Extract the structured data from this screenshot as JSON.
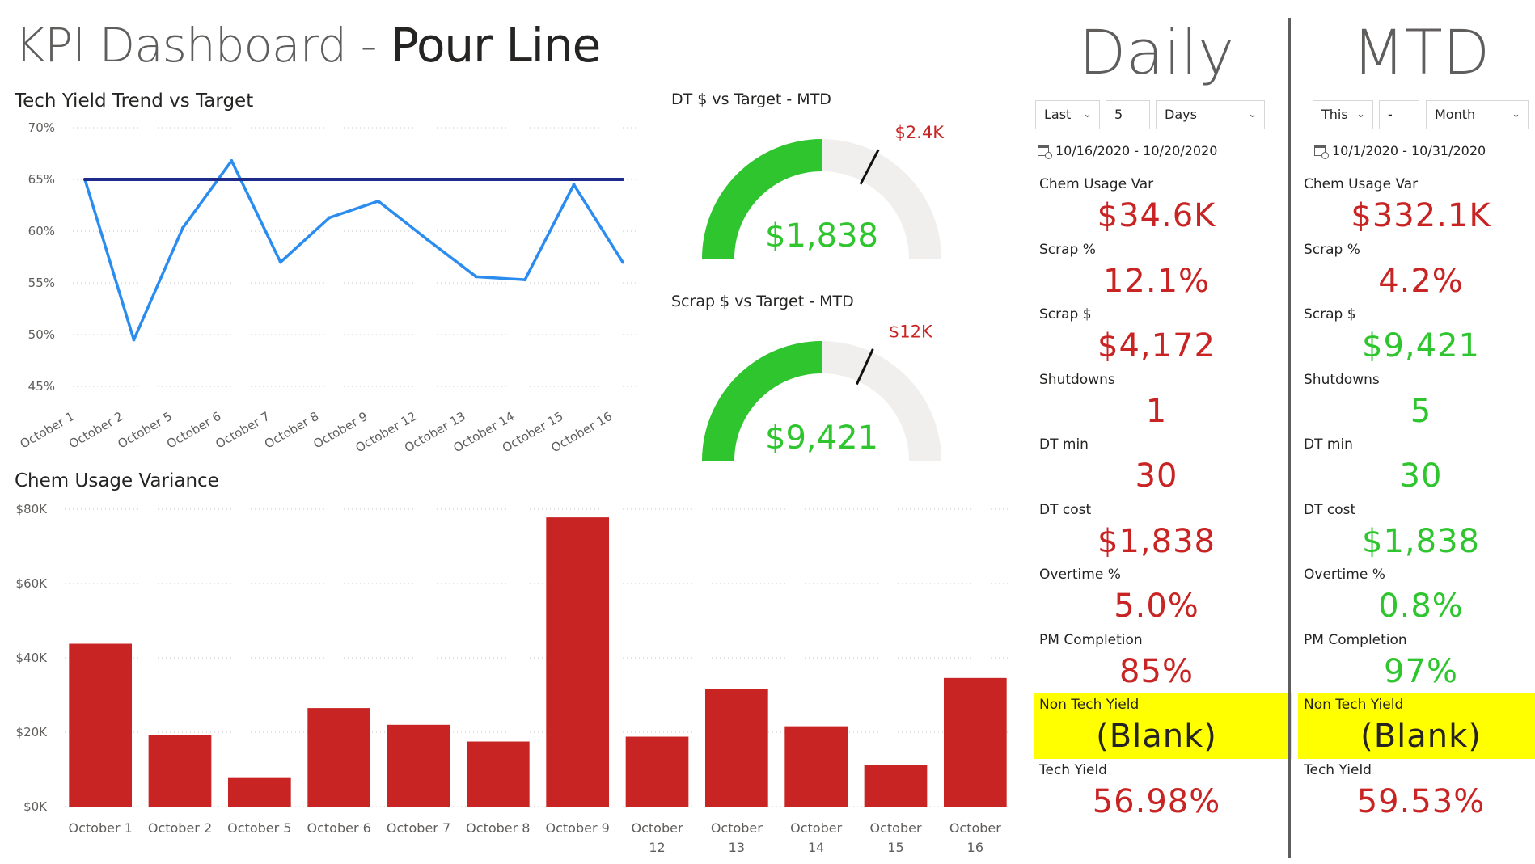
{
  "page": {
    "title_light": "KPI Dashboard - ",
    "title_bold": "Pour Line"
  },
  "tech_yield_chart": {
    "title": "Tech Yield Trend vs Target"
  },
  "chem_chart": {
    "title": "Chem Usage Variance"
  },
  "gauges": [
    {
      "title": "DT $ vs Target - MTD",
      "value_label": "$1,838",
      "target_label": "$2.4K",
      "value": 1838,
      "target": 2400,
      "max": 3676,
      "fill_color": "#2ec52e"
    },
    {
      "title": "Scrap $ vs Target - MTD",
      "value_label": "$9,421",
      "target_label": "$12K",
      "value": 9421,
      "target": 12000,
      "max": 18842,
      "fill_color": "#2ec52e"
    }
  ],
  "chart_data": [
    {
      "type": "line",
      "title": "Tech Yield Trend vs Target",
      "categories": [
        "October 1",
        "October 2",
        "October 5",
        "October 6",
        "October 7",
        "October 8",
        "October 9",
        "October 12",
        "October 13",
        "October 14",
        "October 15",
        "October 16"
      ],
      "series": [
        {
          "values": [
            65.0,
            49.5,
            60.3,
            66.8,
            57.0,
            61.3,
            62.9,
            59.2,
            55.6,
            55.3,
            64.5,
            57.0
          ],
          "color": "#2b8cf0"
        },
        {
          "values": [
            65,
            65,
            65,
            65,
            65,
            65,
            65,
            65,
            65,
            65,
            65,
            65
          ],
          "color": "#1e2a8c"
        }
      ],
      "ylim": [
        45,
        70
      ],
      "yticks": [
        "45%",
        "50%",
        "55%",
        "60%",
        "65%",
        "70%"
      ],
      "ytick_values": [
        45,
        50,
        55,
        60,
        65,
        70
      ],
      "grid": true
    },
    {
      "type": "bar",
      "title": "Chem Usage Variance",
      "categories": [
        "October 1",
        "October 2",
        "October 5",
        "October 6",
        "October 7",
        "October 8",
        "October 9",
        "October 12",
        "October 13",
        "October 14",
        "October 15",
        "October 16"
      ],
      "values": [
        43800,
        19300,
        7900,
        26500,
        22000,
        17500,
        77800,
        18800,
        31600,
        21600,
        11200,
        34600
      ],
      "ylim": [
        0,
        80000
      ],
      "yticks": [
        "$0K",
        "$20K",
        "$40K",
        "$60K",
        "$80K"
      ],
      "ytick_values": [
        0,
        20000,
        40000,
        60000,
        80000
      ],
      "bar_color": "#c92424",
      "grid": true
    }
  ],
  "colors": {
    "red": "#c92424",
    "green": "#2ec52e",
    "yellow": "#ffff00"
  },
  "daily": {
    "heading": "Daily",
    "slicer": {
      "period": "Last",
      "count": "5",
      "unit": "Days"
    },
    "date_range": "10/16/2020 - 10/20/2020",
    "kpis": [
      {
        "label": "Chem Usage Var",
        "value": "$34.6K",
        "color": "#c92424"
      },
      {
        "label": "Scrap %",
        "value": "12.1%",
        "color": "#c92424"
      },
      {
        "label": "Scrap $",
        "value": "$4,172",
        "color": "#c92424"
      },
      {
        "label": "Shutdowns",
        "value": "1",
        "color": "#c92424"
      },
      {
        "label": "DT min",
        "value": "30",
        "color": "#c92424"
      },
      {
        "label": "DT cost",
        "value": "$1,838",
        "color": "#c92424"
      },
      {
        "label": "Overtime %",
        "value": "5.0%",
        "color": "#c92424"
      },
      {
        "label": "PM Completion",
        "value": "85%",
        "color": "#c92424"
      },
      {
        "label": "Non Tech Yield",
        "value": "(Blank)",
        "color": "#252423",
        "highlight": true
      },
      {
        "label": "Tech Yield",
        "value": "56.98%",
        "color": "#c92424"
      }
    ]
  },
  "mtd": {
    "heading": "MTD",
    "slicer": {
      "period": "This",
      "count": "-",
      "unit": "Month"
    },
    "date_range": "10/1/2020 - 10/31/2020",
    "kpis": [
      {
        "label": "Chem Usage Var",
        "value": "$332.1K",
        "color": "#c92424"
      },
      {
        "label": "Scrap %",
        "value": "4.2%",
        "color": "#c92424"
      },
      {
        "label": "Scrap $",
        "value": "$9,421",
        "color": "#2ec52e"
      },
      {
        "label": "Shutdowns",
        "value": "5",
        "color": "#2ec52e"
      },
      {
        "label": "DT min",
        "value": "30",
        "color": "#2ec52e"
      },
      {
        "label": "DT cost",
        "value": "$1,838",
        "color": "#2ec52e"
      },
      {
        "label": "Overtime %",
        "value": "0.8%",
        "color": "#2ec52e"
      },
      {
        "label": "PM Completion",
        "value": "97%",
        "color": "#2ec52e"
      },
      {
        "label": "Non Tech Yield",
        "value": "(Blank)",
        "color": "#252423",
        "highlight": true
      },
      {
        "label": "Tech Yield",
        "value": "59.53%",
        "color": "#c92424"
      }
    ]
  }
}
